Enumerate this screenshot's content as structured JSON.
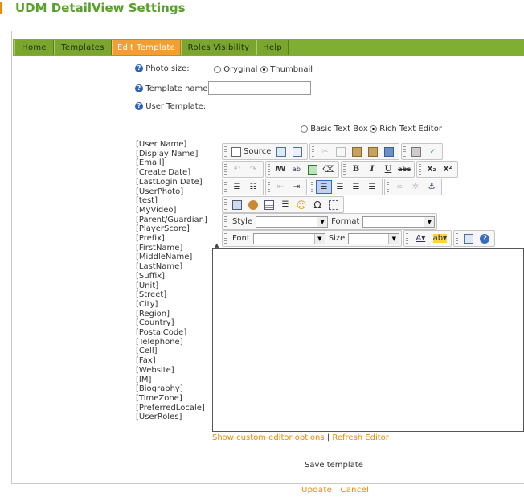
{
  "page": {
    "title": "UDM DetailView Settings"
  },
  "tabs": [
    {
      "label": "Home"
    },
    {
      "label": "Templates"
    },
    {
      "label": "Edit Template",
      "active": true
    },
    {
      "label": "Roles Visibility"
    },
    {
      "label": "Help"
    }
  ],
  "settings": {
    "photo_size_label": "Photo size:",
    "photo_size_options": [
      "Oryginal",
      "Thumbnail"
    ],
    "photo_size_selected": "Thumbnail",
    "template_name_label": "Template name:",
    "template_name_value": "",
    "user_template_label": "User Template:",
    "editor_mode_options": [
      "Basic Text Box",
      "Rich Text Editor"
    ],
    "editor_mode_selected": "Rich Text Editor"
  },
  "fields": [
    "[User Name]",
    "[Display Name]",
    "[Email]",
    "[Create Date]",
    "[LastLogin Date]",
    "[UserPhoto]",
    "[test]",
    "[MyVideo]",
    "[Parent/Guardian]",
    "[PlayerScore]",
    "[Prefix]",
    "[FirstName]",
    "[MiddleName]",
    "[LastName]",
    "[Suffix]",
    "[Unit]",
    "[Street]",
    "[City]",
    "[Region]",
    "[Country]",
    "[PostalCode]",
    "[Telephone]",
    "[Cell]",
    "[Fax]",
    "[Website]",
    "[IM]",
    "[Biography]",
    "[TimeZone]",
    "[PreferredLocale]",
    "[UserRoles]"
  ],
  "editor": {
    "source_label": "Source",
    "style_label": "Style",
    "format_label": "Format",
    "font_label": "Font",
    "size_label": "Size",
    "bold": "B",
    "italic": "I",
    "underline": "U",
    "strike": "abc",
    "subscript": "X₂",
    "superscript": "X²",
    "omega": "Ω",
    "content": ""
  },
  "links": {
    "show_options": "Show custom editor options",
    "separator": "|",
    "refresh": "Refresh Editor",
    "save": "Save template",
    "update": "Update",
    "cancel": "Cancel"
  },
  "colors": {
    "title": "#5aa02c",
    "tabbar": "#80ae32",
    "active_tab": "#f0a030",
    "link": "#ef8a00"
  }
}
